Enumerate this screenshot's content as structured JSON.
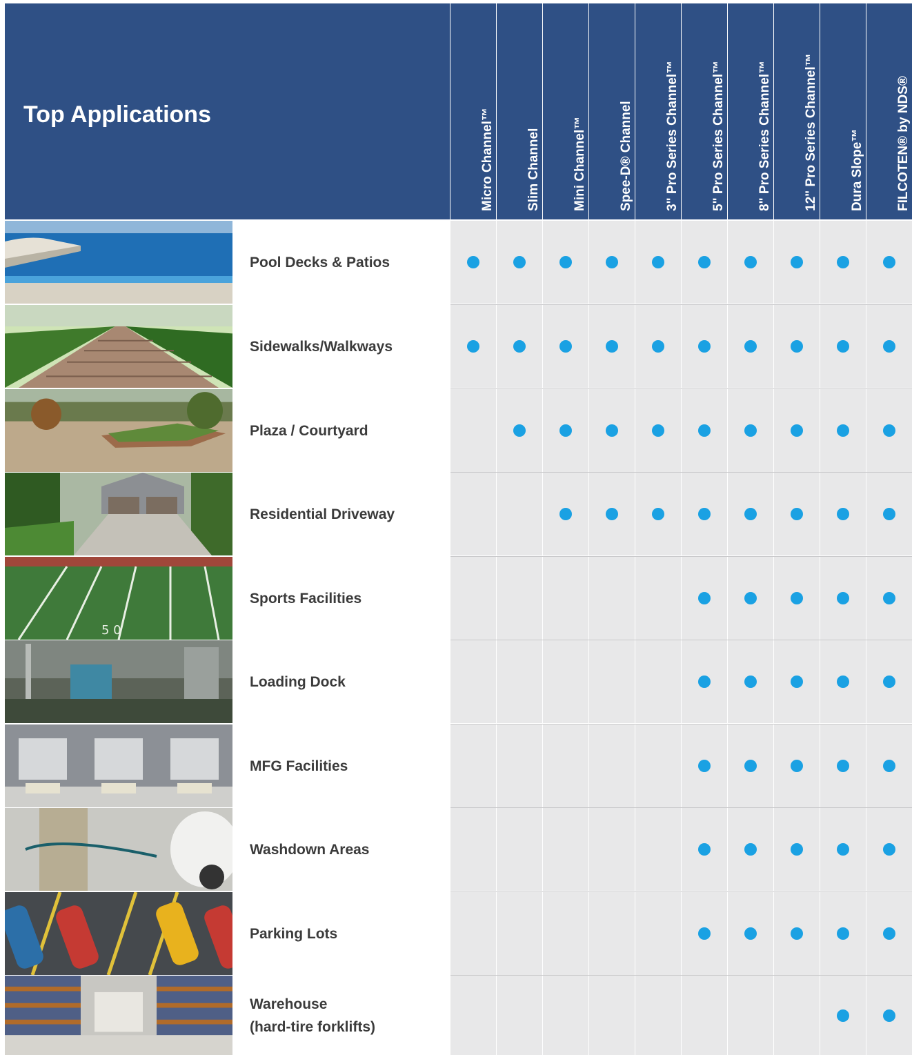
{
  "title": "Top Applications",
  "columns": [
    "Micro Channel™",
    "Slim Channel",
    "Mini Channel™",
    "Spee-D® Channel",
    "3\" Pro Series Channel™",
    "5\" Pro Series Channel™",
    "8\" Pro Series Channel™",
    "12\" Pro Series Channel™",
    "Dura Slope™",
    "FILCOTEN® by NDS®"
  ],
  "rows": [
    {
      "label": "Pool Decks & Patios",
      "photo": "pool-photo",
      "marks": [
        1,
        1,
        1,
        1,
        1,
        1,
        1,
        1,
        1,
        1
      ]
    },
    {
      "label": "Sidewalks/Walkways",
      "photo": "walkway-photo",
      "marks": [
        1,
        1,
        1,
        1,
        1,
        1,
        1,
        1,
        1,
        1
      ]
    },
    {
      "label": "Plaza / Courtyard",
      "photo": "courtyard-photo",
      "marks": [
        0,
        1,
        1,
        1,
        1,
        1,
        1,
        1,
        1,
        1
      ]
    },
    {
      "label": "Residential Driveway",
      "photo": "driveway-photo",
      "marks": [
        0,
        0,
        1,
        1,
        1,
        1,
        1,
        1,
        1,
        1
      ]
    },
    {
      "label": "Sports Facilities",
      "photo": "sports-field-photo",
      "marks": [
        0,
        0,
        0,
        0,
        0,
        1,
        1,
        1,
        1,
        1
      ]
    },
    {
      "label": "Loading Dock",
      "photo": "loading-dock-photo",
      "marks": [
        0,
        0,
        0,
        0,
        0,
        1,
        1,
        1,
        1,
        1
      ]
    },
    {
      "label": "MFG Facilities",
      "photo": "mfg-facility-photo",
      "marks": [
        0,
        0,
        0,
        0,
        0,
        1,
        1,
        1,
        1,
        1
      ]
    },
    {
      "label": "Washdown Areas",
      "photo": "washdown-photo",
      "marks": [
        0,
        0,
        0,
        0,
        0,
        1,
        1,
        1,
        1,
        1
      ]
    },
    {
      "label": "Parking Lots",
      "photo": "parking-lot-photo",
      "marks": [
        0,
        0,
        0,
        0,
        0,
        1,
        1,
        1,
        1,
        1
      ]
    },
    {
      "label": "Warehouse\n(hard-tire forklifts)",
      "photo": "warehouse-photo",
      "marks": [
        0,
        0,
        0,
        0,
        0,
        0,
        0,
        0,
        1,
        1
      ]
    }
  ],
  "colors": {
    "header": "#2f5085",
    "cell": "#e8e8e9",
    "dot": "#1aa1e3",
    "label": "#3b3b3b"
  }
}
